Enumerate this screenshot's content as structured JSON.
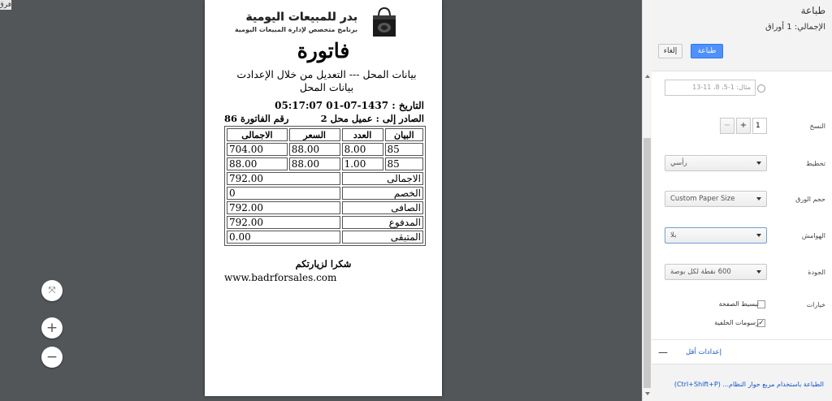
{
  "corner_tab": "فرق",
  "invoice": {
    "logo_title": "بدر للمبيعات اليومية",
    "logo_subtitle": "برنامج متخصص لإدارة المبيعات اليومية",
    "title": "فاتورة",
    "shop_info": "بيانات المحل --- التعديل من خلال الإعدادت بيانات المحل",
    "date_line": "التاريخ : 1437-07-01 05:17:07",
    "customer": "الصادر إلى : عميل محل 2",
    "invoice_number": "رقم الفاتورة 86",
    "headers": [
      "البيان",
      "العدد",
      "السعر",
      "الاجمالى"
    ],
    "rows": [
      [
        "85",
        "8.00",
        "88.00",
        "704.00"
      ],
      [
        "85",
        "1.00",
        "88.00",
        "88.00"
      ]
    ],
    "totals": [
      {
        "label": "الاجمالى",
        "value": "792.00"
      },
      {
        "label": "الخصم",
        "value": "0"
      },
      {
        "label": "الصافى",
        "value": "792.00"
      },
      {
        "label": "المدفوع",
        "value": "792.00"
      },
      {
        "label": "المتبقى",
        "value": "0.00"
      }
    ],
    "thanks": "شكرا لزيارتكم",
    "website": "www.badrforsales.com"
  },
  "zoom": {
    "fit": "⤧",
    "in": "+",
    "out": "−"
  },
  "panel": {
    "heading": "طباعة",
    "total": "الإجمالي: 1 أوراق",
    "print_button": "طباعة",
    "cancel_button": "إلغاء",
    "pages_placeholder": "مثال: 1-5، 8، 11-13",
    "copies_label": "النسخ",
    "copies_value": "1",
    "layout_label": "تخطيط",
    "layout_value": "رأسي",
    "paper_label": "حجم الورق",
    "paper_value": "Custom Paper Size",
    "margins_label": "الهوامش",
    "margins_value": "بلا",
    "quality_label": "الجودة",
    "quality_value": "600 نقطة لكل بوصة",
    "options_label": "خيارات",
    "simplify_label": "تبسيط الصفحة",
    "background_label": "رسومات الخلفية",
    "less_settings": "إعدادات أقل",
    "system_dialog_link": "الطباعة باستخدام مربع حوار النظام... (Ctrl+Shift+P)"
  }
}
